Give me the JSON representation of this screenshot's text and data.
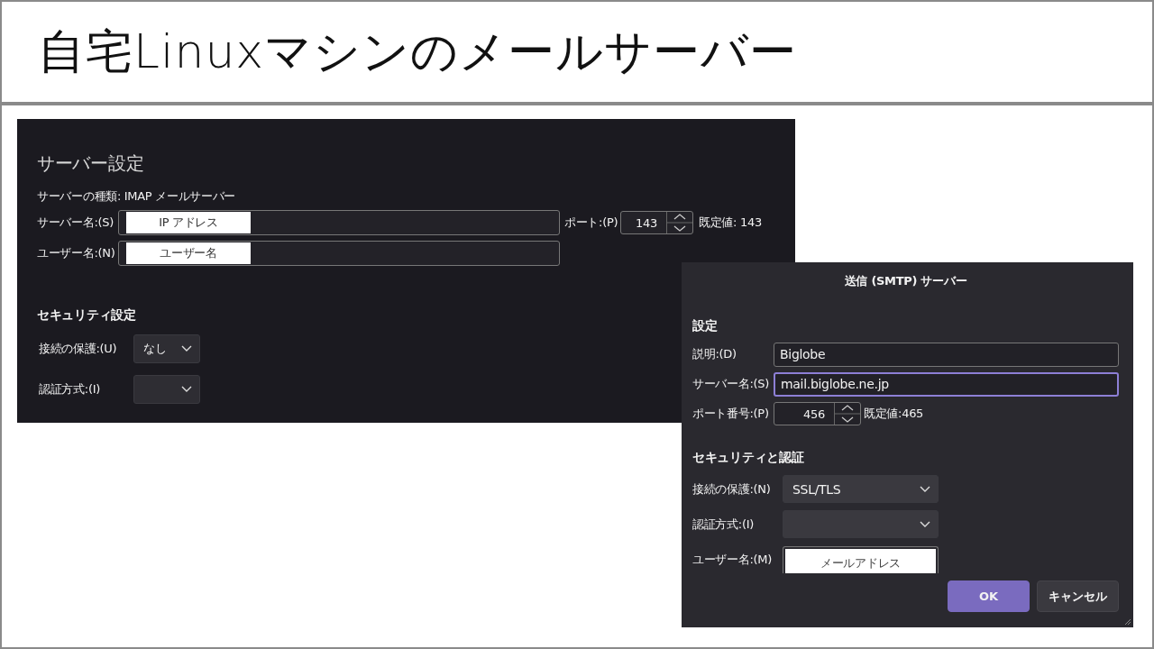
{
  "slide": {
    "title": "自宅Linuxマシンのメールサーバー"
  },
  "incoming_panel": {
    "heading": "サーバー設定",
    "server_type": "サーバーの種類: IMAP メールサーバー",
    "fields": [
      {
        "label": "サーバー名:(S)",
        "overlay_label": "IP アドレス"
      },
      {
        "label": "ユーザー名:(N)",
        "overlay_label": "ユーザー名"
      }
    ],
    "port": {
      "label": "ポート:(P)",
      "value": "143",
      "default": "既定値: 143"
    },
    "security_heading": "セキュリティ設定",
    "selects": [
      {
        "label": "接続の保護:(U)",
        "value": "なし"
      },
      {
        "label": "認証方式:(I)"
      }
    ]
  },
  "smtp_dialog": {
    "title": "送信 (SMTP) サーバー",
    "section": "設定",
    "fields": [
      {
        "label": "説明:(D)",
        "value": "Biglobe",
        "focused": false
      },
      {
        "label": "サーバー名:(S)",
        "value": "mail.biglobe.ne.jp",
        "focused": true
      }
    ],
    "port": {
      "label": "ポート番号:(P)",
      "value": "456",
      "default": "既定値:465"
    },
    "security_heading": "セキュリティと認証",
    "selects": [
      {
        "label": "接続の保護:(N)",
        "value": "SSL/TLS"
      },
      {
        "label": "認証方式:(I)"
      }
    ],
    "username": {
      "label": "ユーザー名:(M)",
      "overlay_label": "メールアドレス"
    },
    "buttons": [
      {
        "label": "OK",
        "kind": "primary"
      },
      {
        "label": "キャンセル",
        "kind": "secondary"
      }
    ]
  }
}
